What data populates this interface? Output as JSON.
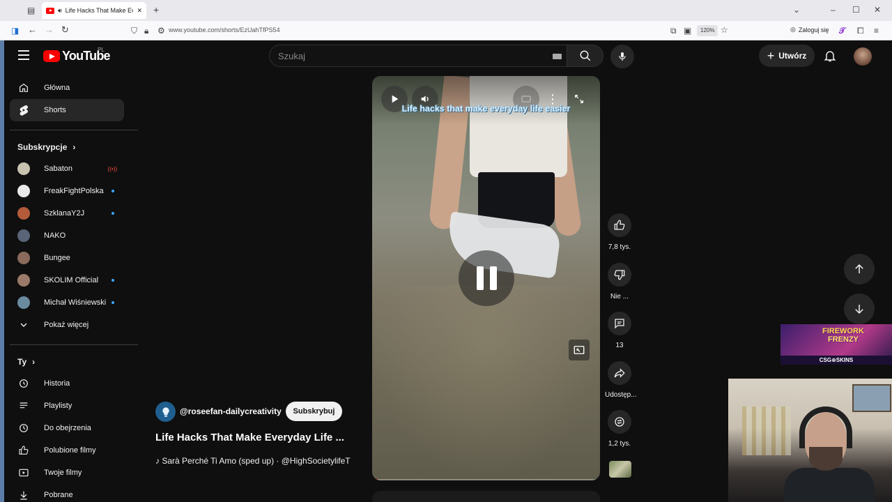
{
  "browser": {
    "tab_title": "Life Hacks That Make Every",
    "url": "www.youtube.com/shorts/EzUahTfPS54",
    "zoom": "120%",
    "login_label": "Zaloguj się"
  },
  "masthead": {
    "logo_text": "YouTube",
    "country_code": "PL",
    "search_placeholder": "Szukaj",
    "create_label": "Utwórz"
  },
  "sidebar": {
    "main": [
      {
        "label": "Główna",
        "icon": "home-icon"
      },
      {
        "label": "Shorts",
        "icon": "shorts-icon",
        "active": true
      }
    ],
    "subscriptions_heading": "Subskrypcje",
    "subscriptions": [
      {
        "label": "Sabaton",
        "status": "live",
        "color": "#c9c2b0"
      },
      {
        "label": "FreakFightPolska",
        "status": "new",
        "color": "#e8e8e8"
      },
      {
        "label": "SzklanaY2J",
        "status": "new",
        "color": "#b25a3a"
      },
      {
        "label": "NAKO",
        "status": "",
        "color": "#5a6478"
      },
      {
        "label": "Bungee",
        "status": "",
        "color": "#8a6a5a"
      },
      {
        "label": "SKOLIM Official",
        "status": "new",
        "color": "#9b7a6a"
      },
      {
        "label": "Michał Wiśniewski",
        "status": "new",
        "color": "#6a8aa0"
      }
    ],
    "show_more": "Pokaż więcej",
    "you_heading": "Ty",
    "you": [
      {
        "label": "Historia",
        "icon": "history-icon"
      },
      {
        "label": "Playlisty",
        "icon": "playlist-icon"
      },
      {
        "label": "Do obejrzenia",
        "icon": "clock-icon"
      },
      {
        "label": "Polubione filmy",
        "icon": "thumb-up-icon"
      },
      {
        "label": "Twoje filmy",
        "icon": "video-icon"
      },
      {
        "label": "Pobrane",
        "icon": "download-icon"
      }
    ]
  },
  "short": {
    "caption": "Life hacks that make everyday life easier",
    "channel": "@roseefan-dailycreativity",
    "subscribe": "Subskrybuj",
    "title": "Life Hacks That Make Everyday Life ...",
    "music": "Sarà Perché Ti Amo (sped up) · @HighSocietylifeT",
    "progress": 0.02
  },
  "actions": {
    "likes": "7,8 tys.",
    "dislike": "Nie ...",
    "comments": "13",
    "share": "Udostęp...",
    "remix": "1,2 tys."
  },
  "overlay": {
    "ad_line1": "FIREWORK",
    "ad_line2": "FRENZY",
    "ad_brand": "CSG⊕SKINS"
  }
}
